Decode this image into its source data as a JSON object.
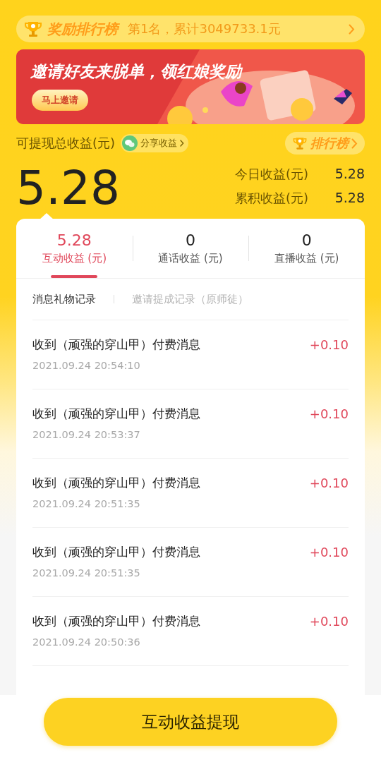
{
  "ticker": {
    "title": "奖励排行榜",
    "text": "第1名，累计3049733.1元"
  },
  "banner": {
    "headline": "邀请好友来脱单，领红娘奖励",
    "button": "马上邀请"
  },
  "summary": {
    "label": "可提现总收益(元)",
    "share_button": "分享收益",
    "ranking_button": "排行榜",
    "total": "5.28",
    "stats": [
      {
        "label": "今日收益(元)",
        "value": "5.28"
      },
      {
        "label": "累积收益(元)",
        "value": "5.28"
      }
    ]
  },
  "tabs": [
    {
      "value": "5.28",
      "label": "互动收益 (元)",
      "selected": true
    },
    {
      "value": "0",
      "label": "通话收益 (元)",
      "selected": false
    },
    {
      "value": "0",
      "label": "直播收益 (元)",
      "selected": false
    }
  ],
  "subtabs": [
    {
      "label": "消息礼物记录",
      "selected": true
    },
    {
      "label": "邀请提成记录（原师徒）",
      "selected": false
    }
  ],
  "records": [
    {
      "title": "收到（顽强的穿山甲）付费消息",
      "time": "2021.09.24 20:54:10",
      "amount": "+0.10"
    },
    {
      "title": "收到（顽强的穿山甲）付费消息",
      "time": "2021.09.24 20:53:37",
      "amount": "+0.10"
    },
    {
      "title": "收到（顽强的穿山甲）付费消息",
      "time": "2021.09.24 20:51:35",
      "amount": "+0.10"
    },
    {
      "title": "收到（顽强的穿山甲）付费消息",
      "time": "2021.09.24 20:51:35",
      "amount": "+0.10"
    },
    {
      "title": "收到（顽强的穿山甲）付费消息",
      "time": "2021.09.24 20:50:36",
      "amount": "+0.10"
    }
  ],
  "withdraw_button": "互动收益提现"
}
